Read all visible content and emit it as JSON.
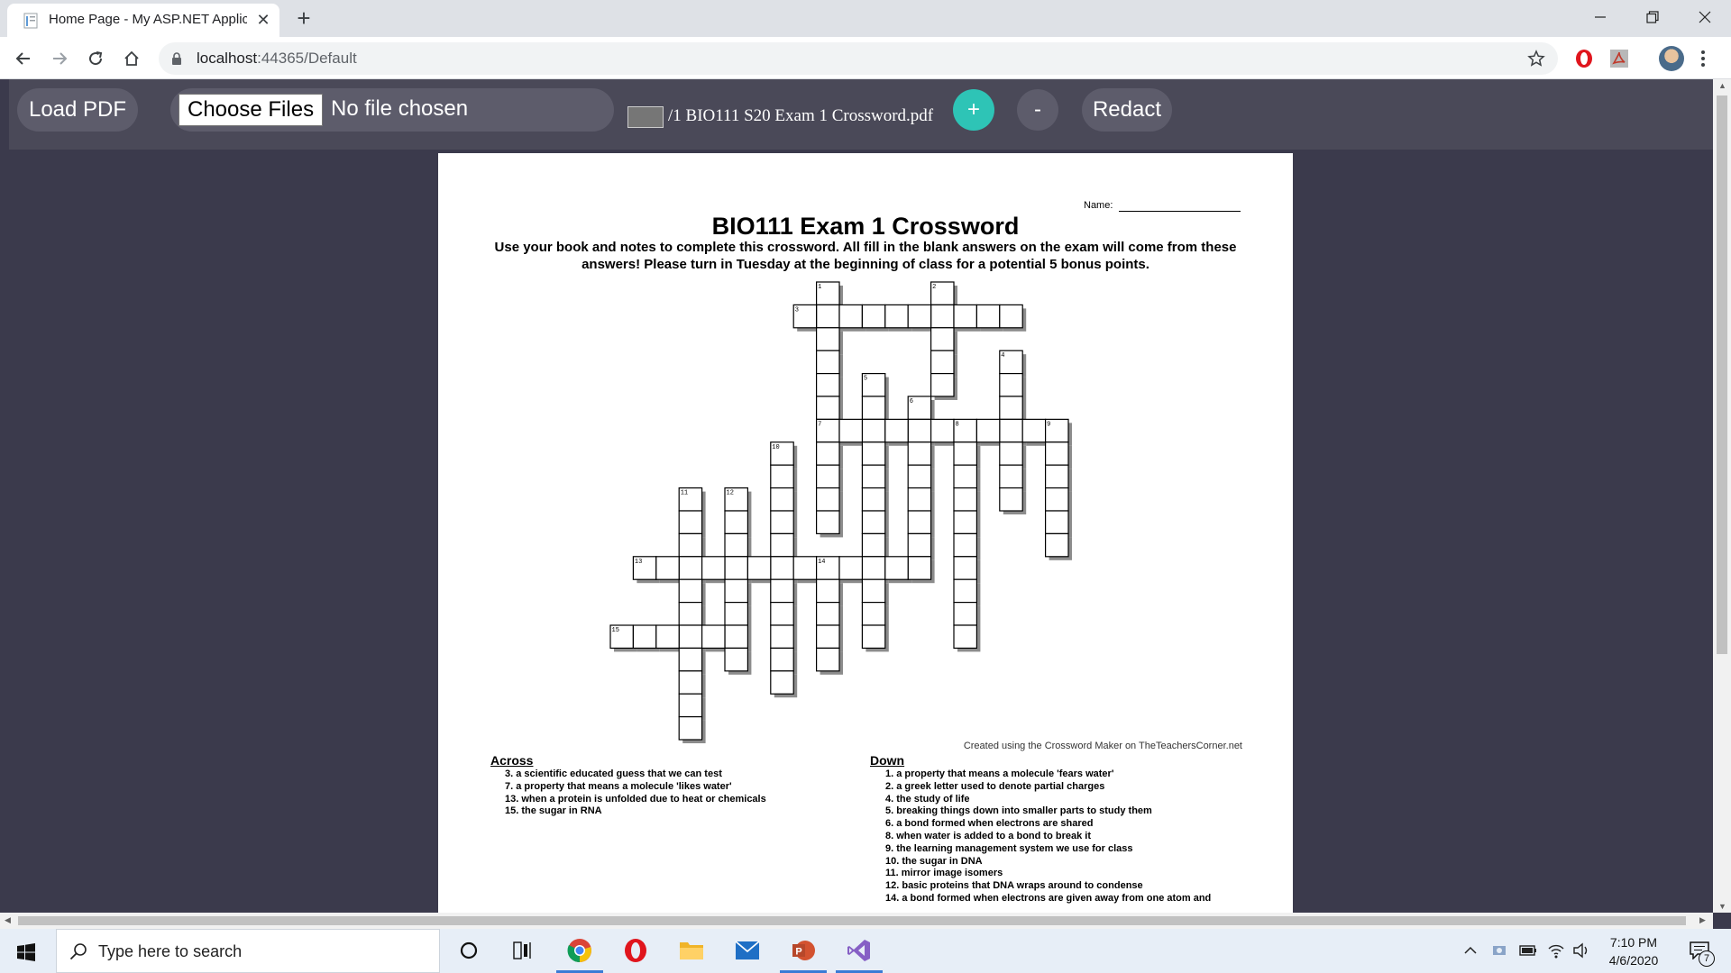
{
  "browser": {
    "tab_title": "Home Page - My ASP.NET Applic",
    "url_host": "localhost",
    "url_path": ":44365/Default"
  },
  "app": {
    "load_pdf_label": "Load PDF",
    "choose_files_label": "Choose Files",
    "no_file_label": "No file chosen",
    "page_label": "/1 BIO111 S20 Exam 1 Crossword.pdf",
    "zoom_in_label": "+",
    "zoom_out_label": "-",
    "redact_label": "Redact",
    "colors": {
      "zoom_in": "#2ec4b6",
      "button": "#5d5c6b",
      "background": "#3b3a4c"
    }
  },
  "document": {
    "name_label": "Name:",
    "title": "BIO111 Exam 1 Crossword",
    "instructions": "Use your book and notes to complete this crossword. All fill in the blank answers on the exam will come from these answers! Please turn in Tuesday at the beginning of class for a potential 5 bonus points.",
    "credit": "Created using the Crossword Maker on TheTeachersCorner.net",
    "across_heading": "Across",
    "down_heading": "Down",
    "across": [
      "3. a scientific educated guess that we can test",
      "7. a property that means a molecule 'likes water'",
      "13. when a protein is unfolded due to heat or chemicals",
      "15. the sugar in RNA"
    ],
    "down": [
      "1. a property that means a molecule 'fears water'",
      "2. a greek letter used to denote partial charges",
      "4. the study of life",
      "5. breaking things down into smaller parts to study them",
      "6. a bond formed when electrons are shared",
      "8. when water is added to a bond to break it",
      "9. the learning management system we use for class",
      "10. the sugar in DNA",
      "11. mirror image isomers",
      "12. basic proteins that DNA wraps around to condense",
      "14. a bond formed when electrons are given away from one atom and"
    ],
    "crossword": {
      "cells": [
        [
          9,
          18
        ],
        [
          9,
          19
        ],
        [
          9,
          20
        ],
        [
          9,
          21
        ],
        [
          9,
          22
        ],
        [
          9,
          23
        ],
        [
          9,
          24
        ],
        [
          9,
          25
        ],
        [
          9,
          26
        ],
        [
          9,
          27
        ],
        [
          9,
          28
        ],
        [
          9,
          29
        ],
        [
          9,
          30
        ],
        [
          10,
          11
        ],
        [
          10,
          12
        ],
        [
          10,
          13
        ],
        [
          10,
          14
        ],
        [
          10,
          15
        ],
        [
          10,
          16
        ],
        [
          10,
          17
        ],
        [
          10,
          18
        ],
        [
          10,
          19
        ],
        [
          10,
          20
        ],
        [
          10,
          21
        ],
        [
          11,
          11
        ],
        [
          11,
          12
        ],
        [
          11,
          13
        ],
        [
          11,
          14
        ],
        [
          11,
          15
        ],
        [
          11,
          16
        ],
        [
          11,
          17
        ],
        [
          11,
          18
        ],
        [
          11,
          19
        ],
        [
          11,
          20
        ],
        [
          11,
          21
        ],
        [
          12,
          1
        ],
        [
          12,
          2
        ],
        [
          12,
          3
        ],
        [
          12,
          4
        ],
        [
          12,
          5
        ],
        [
          12,
          6
        ],
        [
          12,
          7
        ],
        [
          12,
          8
        ],
        [
          12,
          9
        ],
        [
          12,
          10
        ],
        [
          12,
          11
        ],
        [
          12,
          12
        ],
        [
          13,
          7
        ],
        [
          13,
          8
        ],
        [
          13,
          9
        ],
        [
          13,
          10
        ],
        [
          13,
          11
        ],
        [
          13,
          12
        ],
        [
          13,
          13
        ],
        [
          13,
          14
        ],
        [
          13,
          15
        ],
        [
          13,
          16
        ],
        [
          13,
          17
        ],
        [
          13,
          18
        ],
        [
          13,
          19
        ],
        [
          13,
          20
        ],
        [
          13,
          21
        ],
        [
          13,
          22
        ],
        [
          13,
          23
        ],
        [
          13,
          24
        ],
        [
          13,
          25
        ],
        [
          13,
          26
        ],
        [
          13,
          27
        ],
        [
          13,
          28
        ],
        [
          13,
          29
        ],
        [
          14,
          2
        ],
        [
          14,
          3
        ],
        [
          14,
          4
        ],
        [
          14,
          5
        ],
        [
          14,
          6
        ],
        [
          14,
          7
        ],
        [
          14,
          8
        ],
        [
          14,
          9
        ],
        [
          14,
          10
        ],
        [
          14,
          11
        ],
        [
          14,
          12
        ],
        [
          14,
          13
        ],
        [
          14,
          14
        ],
        [
          14,
          15
        ],
        [
          14,
          16
        ],
        [
          14,
          17
        ],
        [
          14,
          18
        ],
        [
          14,
          19
        ],
        [
          14,
          20
        ],
        [
          14,
          21
        ],
        [
          14,
          22
        ],
        [
          14,
          23
        ],
        [
          14,
          24
        ],
        [
          14,
          25
        ],
        [
          14,
          26
        ],
        [
          14,
          27
        ],
        [
          15,
          7
        ],
        [
          15,
          8
        ],
        [
          15,
          9
        ],
        [
          15,
          10
        ],
        [
          15,
          11
        ],
        [
          15,
          12
        ],
        [
          15,
          13
        ],
        [
          15,
          14
        ],
        [
          15,
          15
        ],
        [
          15,
          16
        ],
        [
          15,
          17
        ],
        [
          15,
          18
        ],
        [
          15,
          19
        ],
        [
          15,
          20
        ],
        [
          15,
          21
        ],
        [
          15,
          22
        ],
        [
          15,
          23
        ],
        [
          15,
          24
        ],
        [
          15,
          25
        ],
        [
          15,
          26
        ],
        [
          15,
          27
        ],
        [
          16,
          0
        ],
        [
          16,
          1
        ],
        [
          16,
          2
        ],
        [
          16,
          3
        ],
        [
          16,
          4
        ],
        [
          16,
          5
        ],
        [
          16,
          6
        ],
        [
          16,
          7
        ],
        [
          16,
          8
        ],
        [
          16,
          9
        ],
        [
          16,
          10
        ],
        [
          16,
          11
        ],
        [
          16,
          12
        ],
        [
          16,
          13
        ],
        [
          16,
          14
        ],
        [
          16,
          15
        ],
        [
          16,
          16
        ],
        [
          16,
          17
        ],
        [
          16,
          18
        ],
        [
          16,
          19
        ],
        [
          16,
          20
        ],
        [
          16,
          21
        ],
        [
          16,
          22
        ],
        [
          16,
          23
        ],
        [
          16,
          24
        ],
        [
          16,
          25
        ],
        [
          16,
          26
        ],
        [
          16,
          27
        ],
        [
          16,
          28
        ],
        [
          16,
          29
        ],
        [
          16,
          30
        ],
        [
          16,
          31
        ],
        [
          16,
          32
        ],
        [
          16,
          33
        ],
        [
          16,
          34
        ],
        [
          16,
          35
        ],
        [
          16,
          36
        ],
        [
          16,
          37
        ],
        [
          16,
          38
        ],
        [
          16,
          39
        ],
        [
          16,
          40
        ],
        [
          16,
          41
        ],
        [
          16,
          42
        ],
        [
          17,
          10
        ],
        [
          17,
          11
        ],
        [
          17,
          12
        ],
        [
          17,
          13
        ],
        [
          17,
          14
        ],
        [
          17,
          15
        ],
        [
          17,
          16
        ],
        [
          17,
          17
        ],
        [
          17,
          18
        ],
        [
          17,
          19
        ],
        [
          17,
          20
        ],
        [
          17,
          21
        ],
        [
          17,
          22
        ],
        [
          17,
          23
        ],
        [
          17,
          24
        ],
        [
          17,
          25
        ],
        [
          17,
          26
        ],
        [
          17,
          27
        ],
        [
          17,
          28
        ],
        [
          17,
          29
        ],
        [
          17,
          30
        ],
        [
          18,
          15
        ],
        [
          18,
          16
        ],
        [
          18,
          17
        ],
        [
          18,
          18
        ],
        [
          18,
          19
        ],
        [
          18,
          20
        ],
        [
          18,
          21
        ],
        [
          18,
          22
        ],
        [
          18,
          23
        ],
        [
          18,
          24
        ],
        [
          18,
          25
        ]
      ],
      "numbers": []
    }
  },
  "taskbar": {
    "search_placeholder": "Type here to search",
    "time": "7:10 PM",
    "date": "4/6/2020",
    "notification_count": "7"
  }
}
